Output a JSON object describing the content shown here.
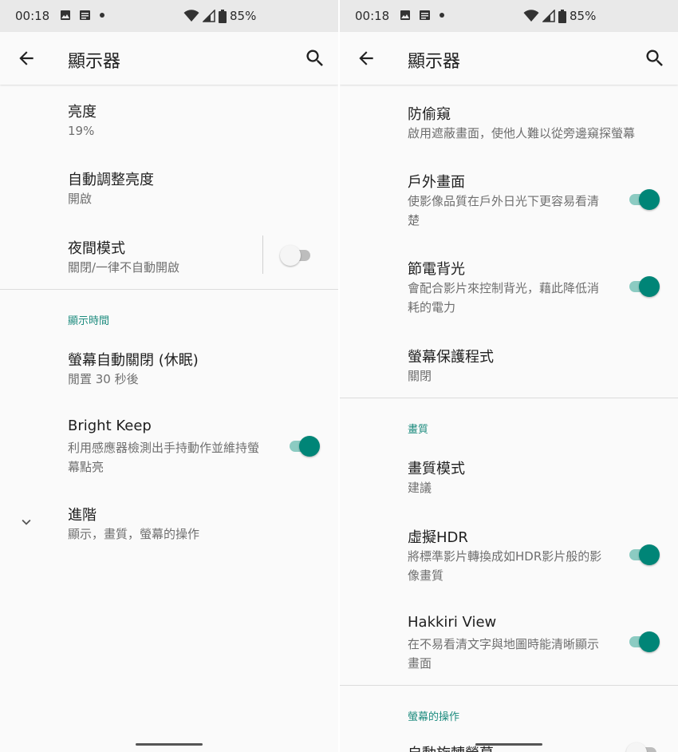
{
  "status_bar": {
    "time": "00:18",
    "battery": "85%"
  },
  "colors": {
    "accent": "#008577",
    "section": "#1e8c7f"
  },
  "left": {
    "title": "顯示器",
    "items": [
      {
        "title": "亮度",
        "summary": "19%"
      },
      {
        "title": "自動調整亮度",
        "summary": "開啟"
      },
      {
        "title": "夜間模式",
        "summary": "關閉/一律不自動開啟",
        "toggle": "off"
      }
    ],
    "section_display_time": "顯示時間",
    "items2": [
      {
        "title": "螢幕自動關閉 (休眠)",
        "summary": "閒置 30 秒後"
      },
      {
        "title": "Bright Keep",
        "summary": "利用感應器檢測出手持動作並維持螢幕點亮",
        "toggle": "on"
      },
      {
        "title": "進階",
        "summary": "顯示，畫質，螢幕的操作"
      }
    ]
  },
  "right": {
    "title": "顯示器",
    "items": [
      {
        "title": "防偷窺",
        "summary": "啟用遮蔽畫面，使他人難以從旁邊窺探螢幕"
      },
      {
        "title": "戶外畫面",
        "summary": "使影像品質在戶外日光下更容易看清楚",
        "toggle": "on"
      },
      {
        "title": "節電背光",
        "summary": "會配合影片來控制背光，藉此降低消耗的電力",
        "toggle": "on"
      },
      {
        "title": "螢幕保護程式",
        "summary": "關閉"
      }
    ],
    "section_quality": "畫質",
    "items2": [
      {
        "title": "畫質模式",
        "summary": "建議"
      },
      {
        "title": "虛擬HDR",
        "summary": "將標準影片轉換成如HDR影片般的影像畫質",
        "toggle": "on"
      },
      {
        "title": "Hakkiri View",
        "summary": "在不易看清文字與地圖時能清晰顯示畫面",
        "toggle": "on"
      }
    ],
    "section_screen_ops": "螢幕的操作",
    "partial_item": {
      "title": "自動旋轉螢幕",
      "toggle": "off"
    }
  },
  "icons": [
    "image-icon",
    "message-icon",
    "wifi-icon",
    "signal-icon",
    "battery-icon",
    "back-arrow-icon",
    "search-icon",
    "chevron-down-icon"
  ]
}
